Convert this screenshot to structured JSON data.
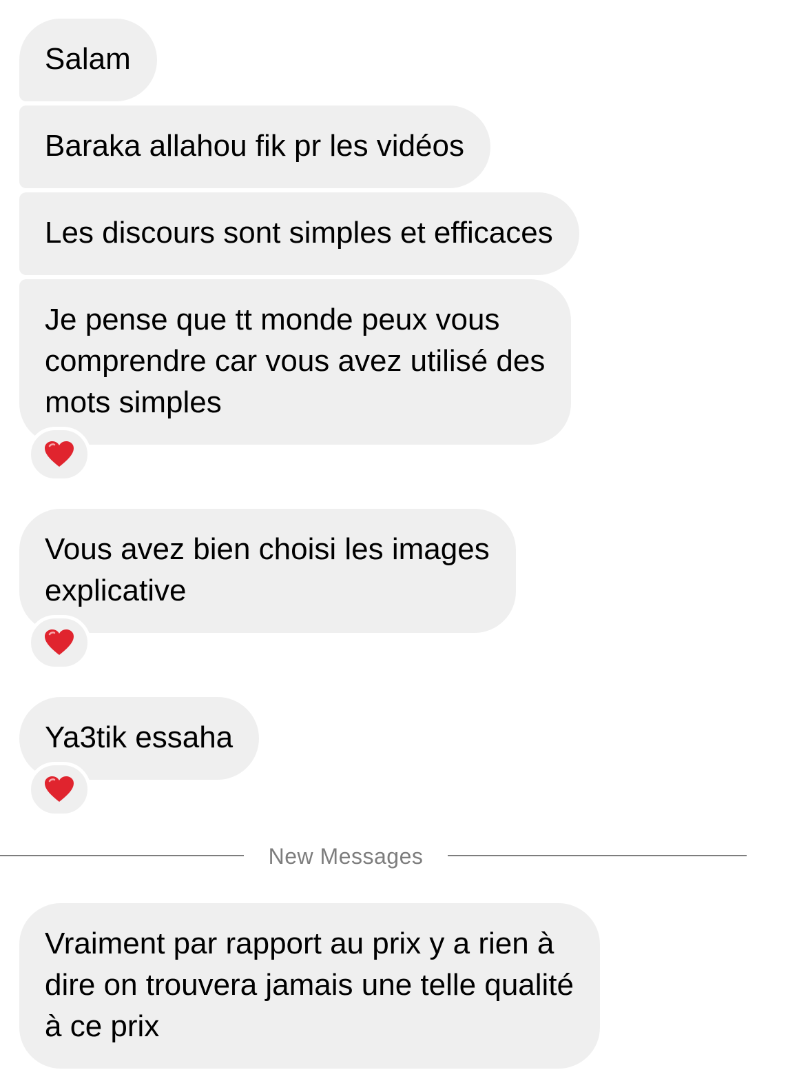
{
  "conversation": {
    "messages": [
      {
        "lines": [
          "Salam"
        ]
      },
      {
        "lines": [
          "Baraka allahou fik pr les vidéos"
        ]
      },
      {
        "lines": [
          "Les discours sont simples et efficaces"
        ]
      },
      {
        "lines": [
          "Je pense que tt monde peux vous",
          "comprendre car vous avez utilisé des",
          "mots simples"
        ],
        "reaction": "red-heart"
      },
      {
        "lines": [
          "Vous avez bien choisi les images",
          "explicative"
        ],
        "reaction": "red-heart"
      },
      {
        "lines": [
          "Ya3tik essaha"
        ],
        "reaction": "red-heart"
      },
      {
        "lines": [
          "Vraiment par rapport au prix y a rien à",
          "dire on trouvera jamais une telle qualité",
          "à ce prix"
        ]
      }
    ],
    "new_messages_label": "New Messages"
  },
  "colors": {
    "bubble_background": "#efefef",
    "divider": "#7d7d7d",
    "heart": "#e0242e"
  }
}
